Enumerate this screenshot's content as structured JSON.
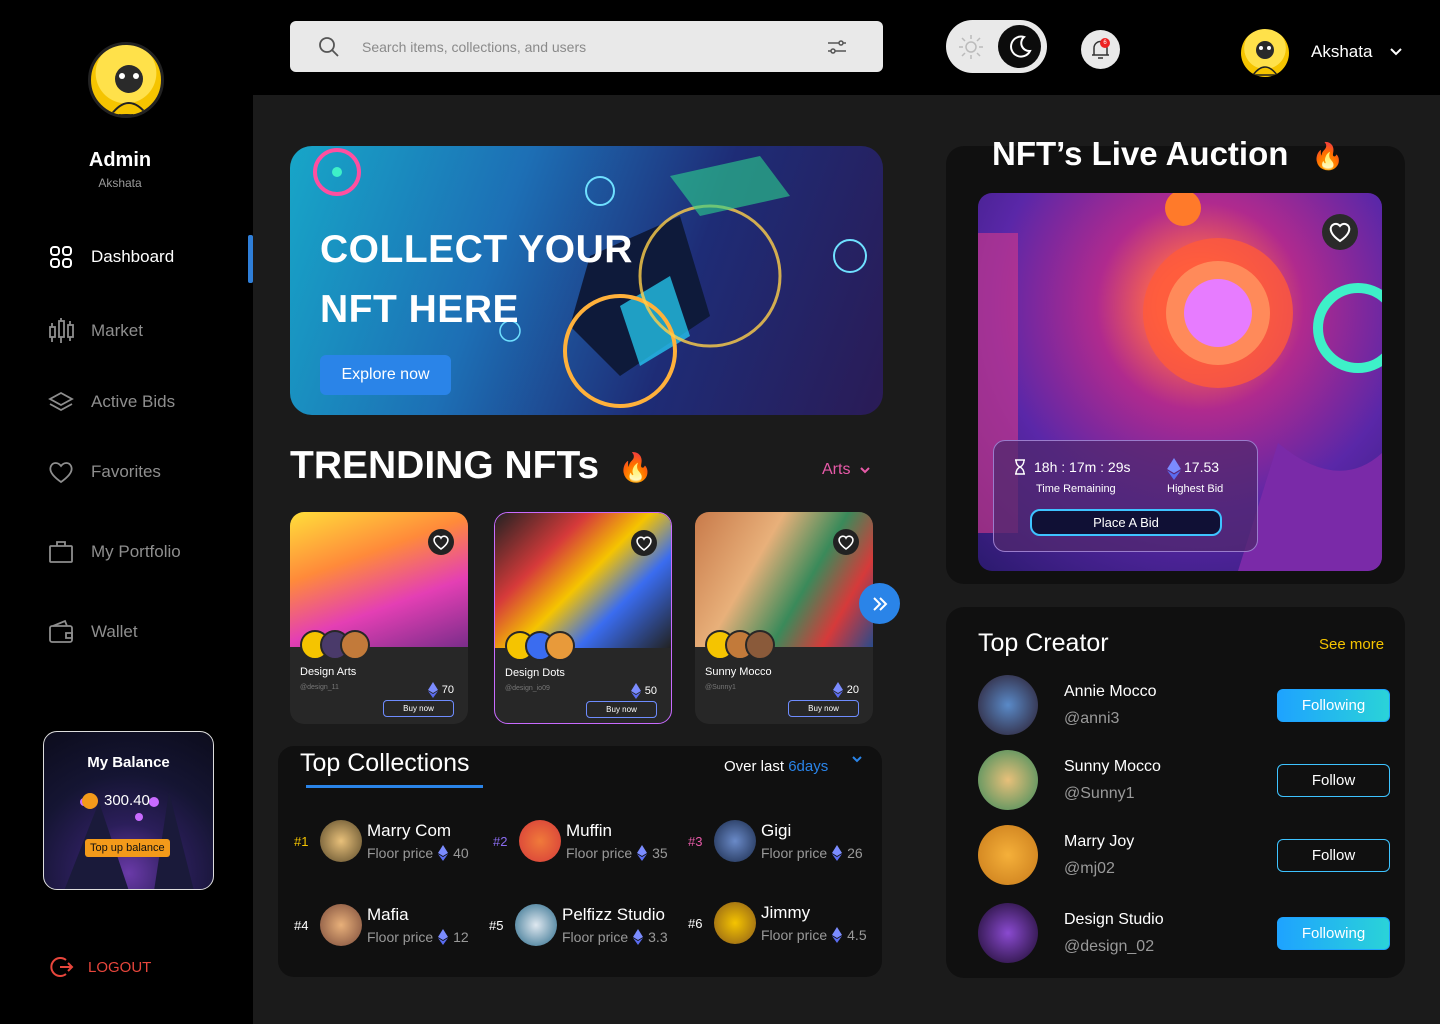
{
  "sidebar": {
    "admin_name": "Admin",
    "admin_sub": "Akshata",
    "items": [
      {
        "label": "Dashboard",
        "icon": "dashboard-icon"
      },
      {
        "label": "Market",
        "icon": "market-icon"
      },
      {
        "label": "Active Bids",
        "icon": "layers-icon"
      },
      {
        "label": "Favorites",
        "icon": "heart-icon"
      },
      {
        "label": "My Portfolio",
        "icon": "briefcase-icon"
      },
      {
        "label": "Wallet",
        "icon": "wallet-icon"
      }
    ],
    "balance": {
      "title": "My Balance",
      "amount": "300.40",
      "topup_label": "Top up balance"
    },
    "logout": "LOGOUT"
  },
  "topbar": {
    "search_placeholder": "Search items, collections, and users",
    "notification_count": "6",
    "user_name": "Akshata"
  },
  "hero": {
    "title_line1": "COLLECT YOUR",
    "title_line2": "NFT HERE",
    "button": "Explore now"
  },
  "trending": {
    "title": "TRENDING NFTs",
    "filter": "Arts",
    "cards": [
      {
        "name": "Design Arts",
        "handle": "@design_11",
        "price": "70",
        "button": "Buy now"
      },
      {
        "name": "Design Dots",
        "handle": "@design_io09",
        "price": "50",
        "button": "Buy now"
      },
      {
        "name": "Sunny Mocco",
        "handle": "@Sunny1",
        "price": "20",
        "button": "Buy now"
      }
    ]
  },
  "collections": {
    "title": "Top Collections",
    "period_prefix": "Over last",
    "period_value": "6days",
    "floor_label": "Floor price",
    "items": [
      {
        "rank": "#1",
        "name": "Marry Com",
        "price": "40",
        "rank_color": "#f5c400"
      },
      {
        "rank": "#2",
        "name": "Muffin",
        "price": "35",
        "rank_color": "#8a6cf0"
      },
      {
        "rank": "#3",
        "name": "Gigi",
        "price": "26",
        "rank_color": "#e75aa8"
      },
      {
        "rank": "#4",
        "name": "Mafia",
        "price": "12",
        "rank_color": "#ffffff"
      },
      {
        "rank": "#5",
        "name": "Pelfizz Studio",
        "price": "3.3",
        "rank_color": "#ffffff"
      },
      {
        "rank": "#6",
        "name": "Jimmy",
        "price": "4.5",
        "rank_color": "#ffffff"
      }
    ]
  },
  "auction": {
    "title": "NFT’s Live Auction",
    "time": "18h : 17m : 29s",
    "time_label": "Time Remaining",
    "bid": "17.53",
    "bid_label": "Highest Bid",
    "button": "Place A Bid"
  },
  "creators": {
    "title": "Top Creator",
    "see_more": "See more",
    "items": [
      {
        "name": "Annie Mocco",
        "handle": "@anni3",
        "button": "Following"
      },
      {
        "name": "Sunny Mocco",
        "handle": "@Sunny1",
        "button": "Follow"
      },
      {
        "name": "Marry Joy",
        "handle": "@mj02",
        "button": "Follow"
      },
      {
        "name": "Design Studio",
        "handle": "@design_02",
        "button": "Following"
      }
    ]
  },
  "colors": {
    "accent": "#2a84e8",
    "pink": "#e75aa8",
    "yellow": "#f5c400",
    "logout": "#e8463c"
  }
}
